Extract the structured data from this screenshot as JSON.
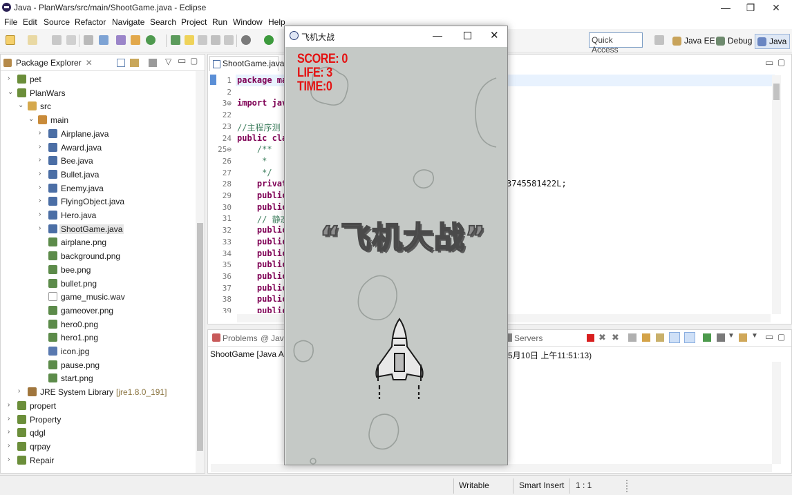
{
  "window": {
    "title": "Java - PlanWars/src/main/ShootGame.java - Eclipse",
    "min": "—",
    "max": "❐",
    "close": "✕"
  },
  "menu": [
    "File",
    "Edit",
    "Source",
    "Refactor",
    "Navigate",
    "Search",
    "Project",
    "Run",
    "Window",
    "Help"
  ],
  "toolbar": {
    "quick_access_placeholder": "Quick Access",
    "perspectives": [
      "Java EE",
      "Debug",
      "Java"
    ]
  },
  "package_explorer": {
    "tab": "Package Explorer",
    "items": [
      {
        "label": "pet",
        "level": 0,
        "arrow": "›",
        "type": "project"
      },
      {
        "label": "PlanWars",
        "level": 0,
        "arrow": "⌄",
        "type": "project"
      },
      {
        "label": "src",
        "level": 1,
        "arrow": "⌄",
        "type": "folder"
      },
      {
        "label": "main",
        "level": 2,
        "arrow": "⌄",
        "type": "package"
      },
      {
        "label": "Airplane.java",
        "level": 3,
        "arrow": "›",
        "type": "java"
      },
      {
        "label": "Award.java",
        "level": 3,
        "arrow": "›",
        "type": "java"
      },
      {
        "label": "Bee.java",
        "level": 3,
        "arrow": "›",
        "type": "java"
      },
      {
        "label": "Bullet.java",
        "level": 3,
        "arrow": "›",
        "type": "java"
      },
      {
        "label": "Enemy.java",
        "level": 3,
        "arrow": "›",
        "type": "java"
      },
      {
        "label": "FlyingObject.java",
        "level": 3,
        "arrow": "›",
        "type": "java"
      },
      {
        "label": "Hero.java",
        "level": 3,
        "arrow": "›",
        "type": "java"
      },
      {
        "label": "ShootGame.java",
        "level": 3,
        "arrow": "›",
        "type": "java",
        "selected": true
      },
      {
        "label": "airplane.png",
        "level": 3,
        "arrow": "",
        "type": "image"
      },
      {
        "label": "background.png",
        "level": 3,
        "arrow": "",
        "type": "image"
      },
      {
        "label": "bee.png",
        "level": 3,
        "arrow": "",
        "type": "image"
      },
      {
        "label": "bullet.png",
        "level": 3,
        "arrow": "",
        "type": "image"
      },
      {
        "label": "game_music.wav",
        "level": 3,
        "arrow": "",
        "type": "file"
      },
      {
        "label": "gameover.png",
        "level": 3,
        "arrow": "",
        "type": "image"
      },
      {
        "label": "hero0.png",
        "level": 3,
        "arrow": "",
        "type": "image"
      },
      {
        "label": "hero1.png",
        "level": 3,
        "arrow": "",
        "type": "image"
      },
      {
        "label": "icon.jpg",
        "level": 3,
        "arrow": "",
        "type": "jpg"
      },
      {
        "label": "pause.png",
        "level": 3,
        "arrow": "",
        "type": "image"
      },
      {
        "label": "start.png",
        "level": 3,
        "arrow": "",
        "type": "image"
      },
      {
        "label": "JRE System Library",
        "level": 1,
        "arrow": "›",
        "type": "library",
        "suffix": "[jre1.8.0_191]"
      },
      {
        "label": "propert",
        "level": 0,
        "arrow": "›",
        "type": "project"
      },
      {
        "label": "Property",
        "level": 0,
        "arrow": "›",
        "type": "project"
      },
      {
        "label": "qdgl",
        "level": 0,
        "arrow": "›",
        "type": "project"
      },
      {
        "label": "qrpay",
        "level": 0,
        "arrow": "›",
        "type": "project"
      },
      {
        "label": "Repair",
        "level": 0,
        "arrow": "›",
        "type": "project"
      }
    ]
  },
  "editor": {
    "tab": "ShootGame.java",
    "lines": [
      {
        "n": "1",
        "code": "package ma"
      },
      {
        "n": "2",
        "code": ""
      },
      {
        "n": "3⊕",
        "code": "import jav"
      },
      {
        "n": "22",
        "code": ""
      },
      {
        "n": "23",
        "code": "//主程序测"
      },
      {
        "n": "24",
        "code": "public cla"
      },
      {
        "n": "25⊖",
        "code": "    /**"
      },
      {
        "n": "26",
        "code": "     *"
      },
      {
        "n": "27",
        "code": "     */"
      },
      {
        "n": "28",
        "code": "    privat"
      },
      {
        "n": "29",
        "code": "    public"
      },
      {
        "n": "30",
        "code": "    public"
      },
      {
        "n": "31",
        "code": "    // 静态"
      },
      {
        "n": "32",
        "code": "    public"
      },
      {
        "n": "33",
        "code": "    public"
      },
      {
        "n": "34",
        "code": "    public"
      },
      {
        "n": "35",
        "code": "    public"
      },
      {
        "n": "36",
        "code": "    public"
      },
      {
        "n": "37",
        "code": "    public"
      },
      {
        "n": "38",
        "code": "    public"
      },
      {
        "n": "39",
        "code": "    public"
      }
    ],
    "right_fragment": "3745581422L;"
  },
  "console": {
    "tabs": [
      "Problems",
      "Java",
      "Servers"
    ],
    "line_left": "ShootGame [Java App",
    "line_right": "5月10日 上午11:51:13)"
  },
  "status": {
    "writable": "Writable",
    "insert": "Smart Insert",
    "position": "1 : 1"
  },
  "game": {
    "title": "飞机大战",
    "score_label": "SCORE: 0",
    "life_label": "LIFE: 3",
    "time_label": "TIME:0",
    "logo": "“飞机大战”"
  }
}
